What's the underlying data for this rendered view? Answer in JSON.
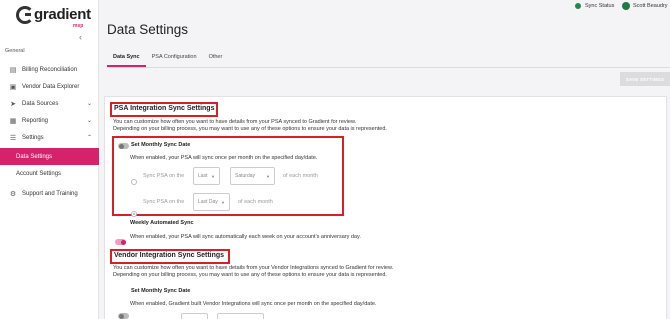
{
  "app": {
    "logo_text": "gradient",
    "logo_sub": "msp"
  },
  "sidebar": {
    "section": "General",
    "items": [
      {
        "label": "Billing Reconciliation",
        "icon": "billing-icon"
      },
      {
        "label": "Vendor Data Explorer",
        "icon": "explorer-icon"
      },
      {
        "label": "Data Sources",
        "icon": "data-sources-icon"
      },
      {
        "label": "Reporting",
        "icon": "reporting-icon"
      },
      {
        "label": "Settings",
        "icon": "settings-icon"
      },
      {
        "label": "Data Settings"
      },
      {
        "label": "Account Settings"
      },
      {
        "label": "Support and Training",
        "icon": "support-icon"
      }
    ]
  },
  "topbar": {
    "sync_status": "Sync Status",
    "user_name": "Scott Beaudry"
  },
  "page": {
    "title": "Data Settings"
  },
  "tabs": [
    {
      "label": "Data Sync"
    },
    {
      "label": "PSA Configuration"
    },
    {
      "label": "Other"
    }
  ],
  "toolbar": {
    "save_label": "SAVE SETTINGS"
  },
  "psa": {
    "heading": "PSA Integration Sync Settings",
    "desc1": "You can customize how often you want to have details from your PSA synced to Gradient for review.",
    "desc2": "Depending on your billing process, you may want to use any of these options to ensure your data is represented.",
    "monthly_label": "Set Monthly Sync Date",
    "monthly_desc": "When enabled, your PSA will sync once per month on the specified day/date.",
    "option1": {
      "prefix": "Sync PSA on the",
      "select1": "Last",
      "select2": "Saturday",
      "suffix": "of each month"
    },
    "option2": {
      "prefix": "Sync PSA on the",
      "select1": "Last Day",
      "suffix": "of each month"
    },
    "weekly_label": "Weekly Automated Sync",
    "weekly_desc": "When enabled, your PSA will sync automatically each week on your account's anniversary day."
  },
  "vendor": {
    "heading": "Vendor Integration Sync Settings",
    "desc1": "You can customize how often you want to have details from your Vendor Integrations synced to Gradient for review.",
    "desc2": "Depending on your billing process, you may want to use any of these options to ensure your data is represented.",
    "monthly_label": "Set Monthly Sync Date",
    "monthly_desc": "When enabled, Gradient built Vendor Integrations will sync once per month on the specified day/date."
  },
  "colors": {
    "accent": "#d4236b",
    "highlight": "#d81f26",
    "status_ok": "#1e8a4c"
  }
}
